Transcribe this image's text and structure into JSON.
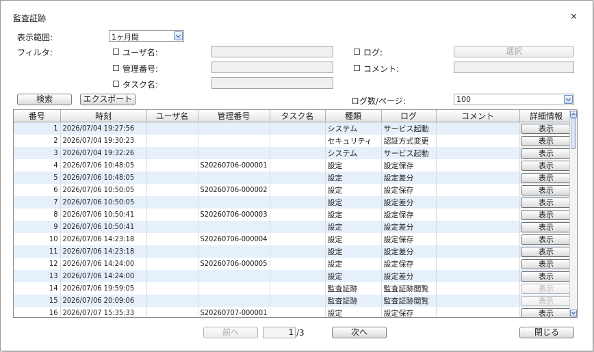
{
  "dialog": {
    "title": "監査証跡",
    "close_glyph": "×"
  },
  "filters": {
    "range_label": "表示範囲:",
    "range_value": "1ヶ月間",
    "filter_label": "フィルタ:",
    "user_label": "ユーザ名:",
    "mgmt_label": "管理番号:",
    "task_label": "タスク名:",
    "log_label": "ログ:",
    "comment_label": "コメント:",
    "select_button": "選択"
  },
  "toolbar": {
    "search_button": "検索",
    "export_button": "エクスポート",
    "per_page_label": "ログ数/ページ:",
    "per_page_value": "100"
  },
  "table": {
    "columns": [
      "番号",
      "時刻",
      "ユーザ名",
      "管理番号",
      "タスク名",
      "種類",
      "ログ",
      "コメント",
      "詳細情報"
    ],
    "show_label": "表示",
    "rows": [
      {
        "no": "1",
        "time": "2026/07/04 19:27:56",
        "user": "",
        "mgmt": "",
        "task": "",
        "type": "システム",
        "log": "サービス起動",
        "comment": "",
        "enabled": true
      },
      {
        "no": "2",
        "time": "2026/07/04 19:30:23",
        "user": "",
        "mgmt": "",
        "task": "",
        "type": "セキュリティ",
        "log": "認証方式変更",
        "comment": "",
        "enabled": true
      },
      {
        "no": "3",
        "time": "2026/07/04 19:32:26",
        "user": "",
        "mgmt": "",
        "task": "",
        "type": "システム",
        "log": "サービス起動",
        "comment": "",
        "enabled": true
      },
      {
        "no": "4",
        "time": "2026/07/06 10:48:05",
        "user": "",
        "mgmt": "S20260706-000001",
        "task": "",
        "type": "設定",
        "log": "設定保存",
        "comment": "",
        "enabled": true
      },
      {
        "no": "5",
        "time": "2026/07/06 10:48:05",
        "user": "",
        "mgmt": "",
        "task": "",
        "type": "設定",
        "log": "設定差分",
        "comment": "",
        "enabled": true
      },
      {
        "no": "6",
        "time": "2026/07/06 10:50:05",
        "user": "",
        "mgmt": "S20260706-000002",
        "task": "",
        "type": "設定",
        "log": "設定保存",
        "comment": "",
        "enabled": true
      },
      {
        "no": "7",
        "time": "2026/07/06 10:50:05",
        "user": "",
        "mgmt": "",
        "task": "",
        "type": "設定",
        "log": "設定差分",
        "comment": "",
        "enabled": true
      },
      {
        "no": "8",
        "time": "2026/07/06 10:50:41",
        "user": "",
        "mgmt": "S20260706-000003",
        "task": "",
        "type": "設定",
        "log": "設定保存",
        "comment": "",
        "enabled": true
      },
      {
        "no": "9",
        "time": "2026/07/06 10:50:41",
        "user": "",
        "mgmt": "",
        "task": "",
        "type": "設定",
        "log": "設定差分",
        "comment": "",
        "enabled": true
      },
      {
        "no": "10",
        "time": "2026/07/06 14:23:18",
        "user": "",
        "mgmt": "S20260706-000004",
        "task": "",
        "type": "設定",
        "log": "設定保存",
        "comment": "",
        "enabled": true
      },
      {
        "no": "11",
        "time": "2026/07/06 14:23:18",
        "user": "",
        "mgmt": "",
        "task": "",
        "type": "設定",
        "log": "設定差分",
        "comment": "",
        "enabled": true
      },
      {
        "no": "12",
        "time": "2026/07/06 14:24:00",
        "user": "",
        "mgmt": "S20260706-000005",
        "task": "",
        "type": "設定",
        "log": "設定保存",
        "comment": "",
        "enabled": true
      },
      {
        "no": "13",
        "time": "2026/07/06 14:24:00",
        "user": "",
        "mgmt": "",
        "task": "",
        "type": "設定",
        "log": "設定差分",
        "comment": "",
        "enabled": true
      },
      {
        "no": "14",
        "time": "2026/07/06 19:59:05",
        "user": "",
        "mgmt": "",
        "task": "",
        "type": "監査証跡",
        "log": "監査証跡閲覧",
        "comment": "",
        "enabled": false
      },
      {
        "no": "15",
        "time": "2026/07/06 20:09:06",
        "user": "",
        "mgmt": "",
        "task": "",
        "type": "監査証跡",
        "log": "監査証跡閲覧",
        "comment": "",
        "enabled": false
      },
      {
        "no": "16",
        "time": "2026/07/07 15:35:33",
        "user": "",
        "mgmt": "S20260707-000001",
        "task": "",
        "type": "設定",
        "log": "設定保存",
        "comment": "",
        "enabled": true
      }
    ]
  },
  "pagination": {
    "prev_button": "前へ",
    "current_page": "1",
    "total": "/3",
    "next_button": "次へ",
    "close_button": "閉じる"
  }
}
